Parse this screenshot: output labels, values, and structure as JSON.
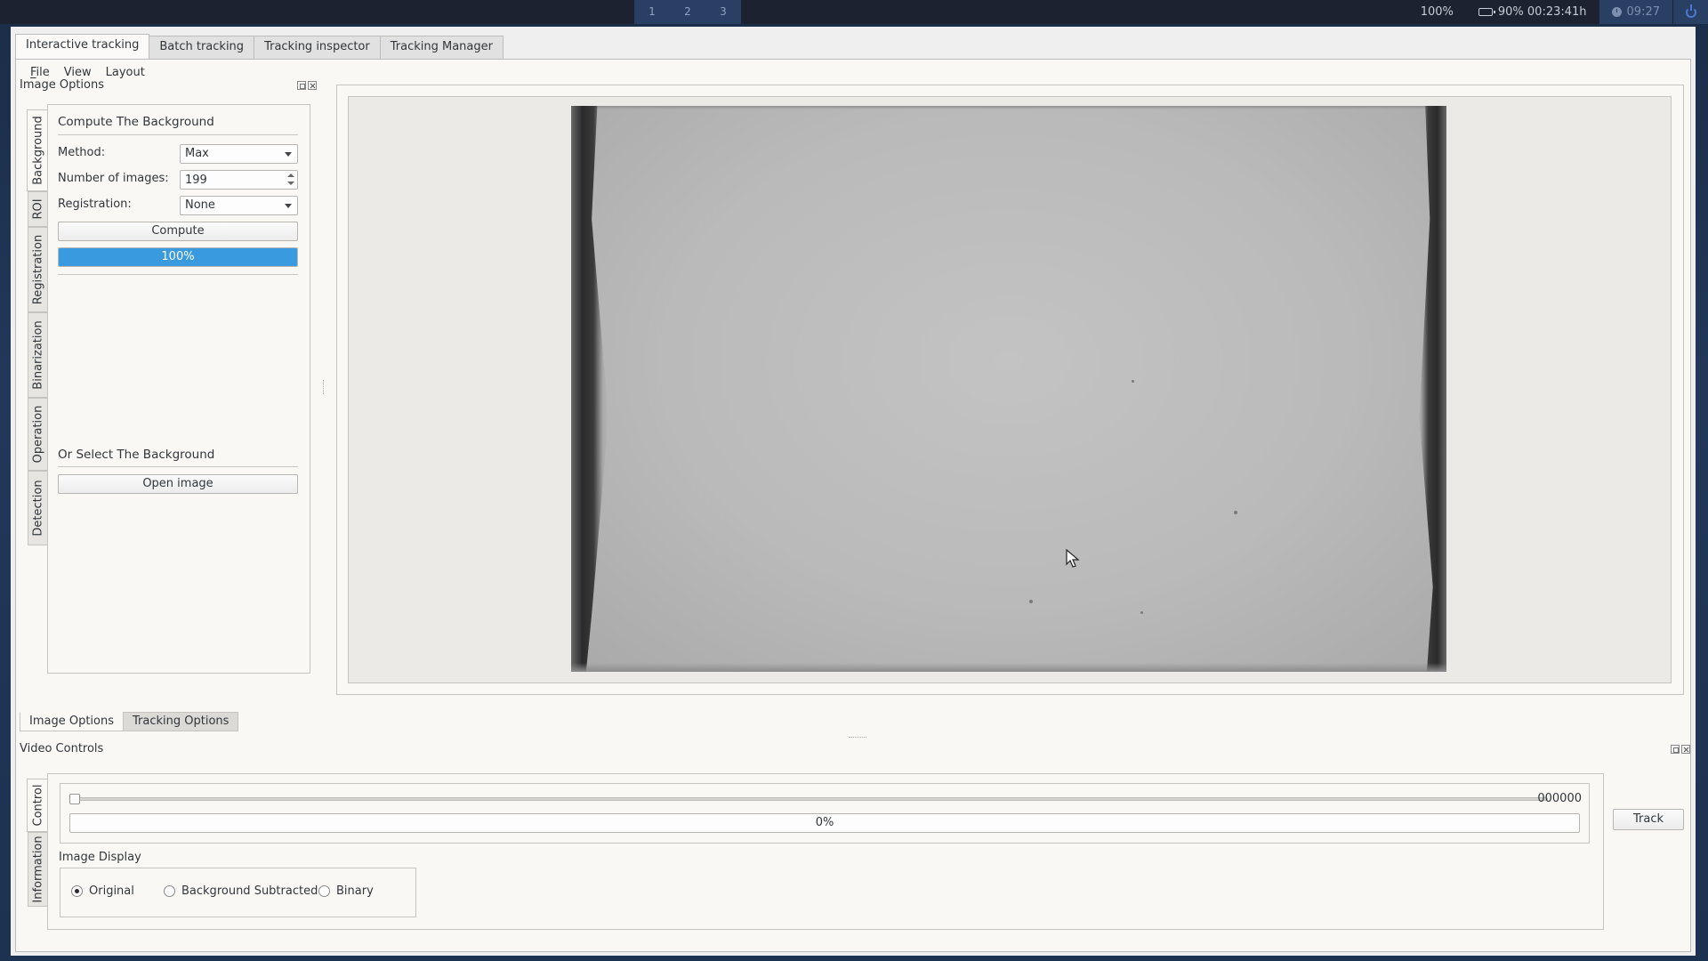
{
  "system_bar": {
    "workspaces": [
      "1",
      "2",
      "3"
    ],
    "zoom": "100%",
    "battery": "90% 00:23:41h",
    "clock": "09:27",
    "icons": [
      "battery-icon",
      "clock-icon",
      "power-icon"
    ]
  },
  "main_tabs": [
    "Interactive tracking",
    "Batch tracking",
    "Tracking inspector",
    "Tracking Manager"
  ],
  "menu": [
    "File",
    "View",
    "Layout"
  ],
  "image_options": {
    "title": "Image Options",
    "vertical_tabs": [
      "Background",
      "ROI",
      "Registration",
      "Binarization",
      "Operation",
      "Detection"
    ],
    "compute_title": "Compute The Background",
    "method_label": "Method:",
    "method_value": "Max",
    "num_images_label": "Number of images:",
    "num_images_value": "199",
    "registration_label": "Registration:",
    "registration_value": "None",
    "compute_button": "Compute",
    "progress": "100%",
    "progress_value": 1.0,
    "select_title": "Or Select The Background",
    "open_button": "Open image"
  },
  "left_bottom_tabs": [
    "Image Options",
    "Tracking Options"
  ],
  "video_controls": {
    "title": "Video Controls",
    "vertical_tabs": [
      "Control",
      "Information"
    ],
    "frame_counter": "000000",
    "progress": "0%",
    "progress_value": 0.0,
    "display_title": "Image Display",
    "radios": [
      "Original",
      "Background Subtracted",
      "Binary"
    ],
    "selected_radio": "Original",
    "track_button": "Track"
  },
  "colors": {
    "accent": "#3a9ae0",
    "window_bg": "#faf8f5",
    "system_bar": "#1c2230"
  }
}
